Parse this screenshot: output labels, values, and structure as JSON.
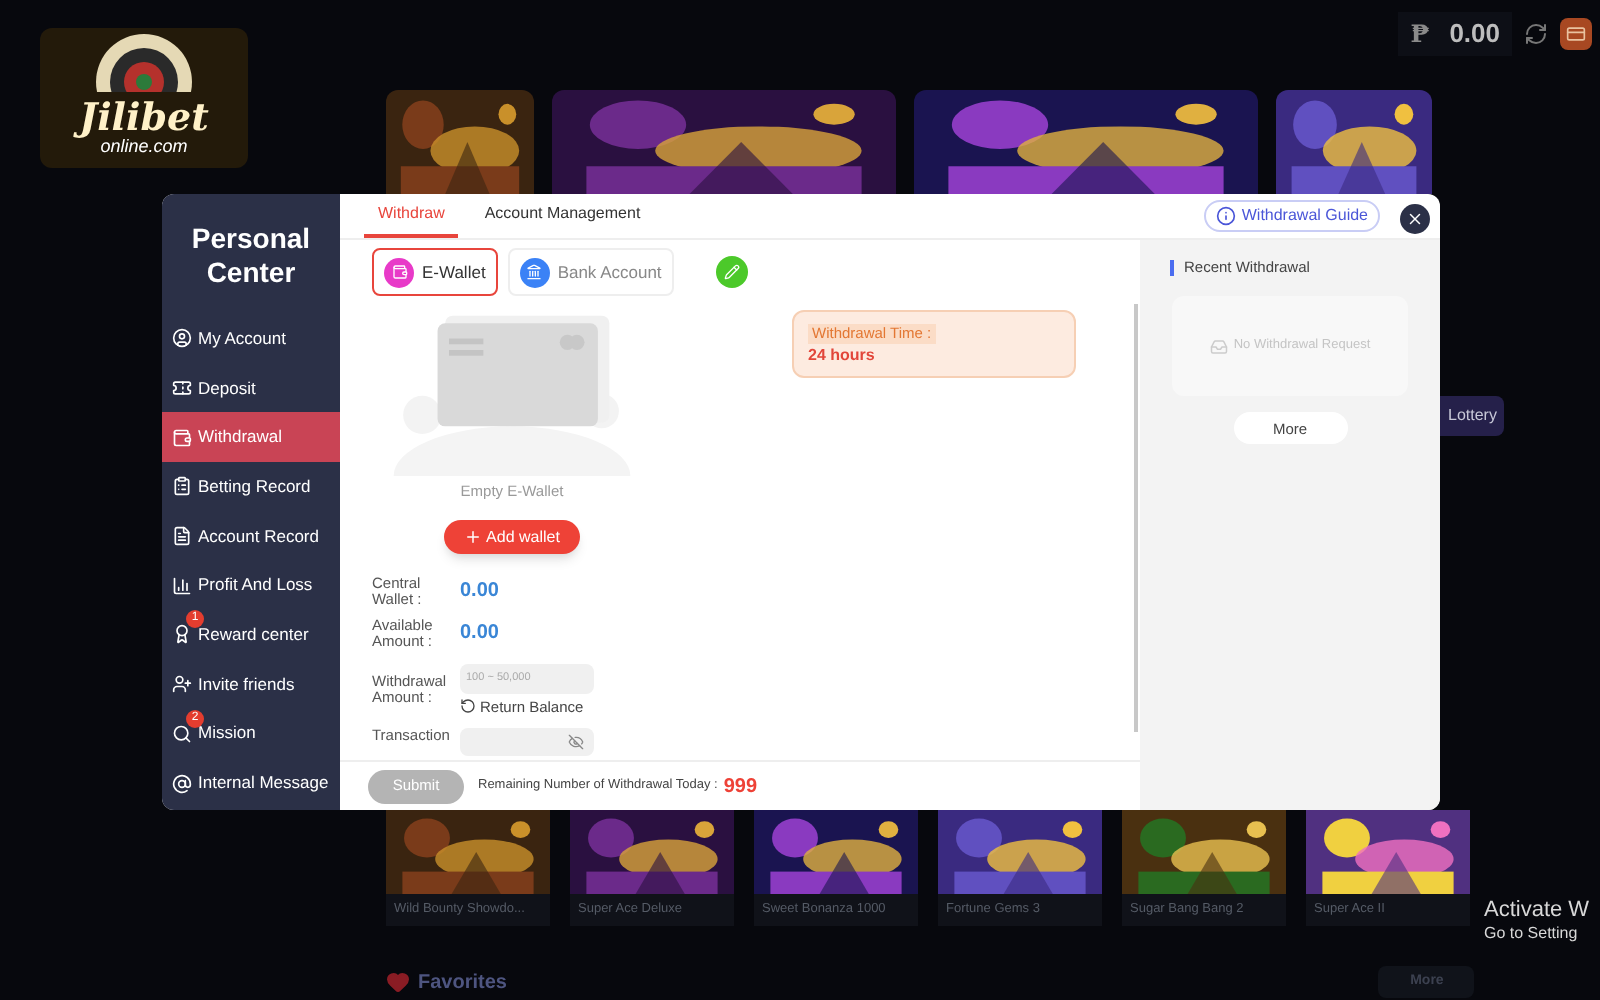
{
  "logo": {
    "name": "Jilibet",
    "domain": "online.com"
  },
  "balance": {
    "currency": "₱",
    "amount": "0.00"
  },
  "side_chip": "Lottery",
  "dialog": {
    "title": "Personal Center",
    "menu": [
      {
        "label": "My Account",
        "selected": false
      },
      {
        "label": "Deposit",
        "selected": false
      },
      {
        "label": "Withdrawal",
        "selected": true
      },
      {
        "label": "Betting Record",
        "selected": false
      },
      {
        "label": "Account Record",
        "selected": false
      },
      {
        "label": "Profit And Loss",
        "selected": false
      },
      {
        "label": "Reward center",
        "selected": false,
        "badge": "1"
      },
      {
        "label": "Invite friends",
        "selected": false
      },
      {
        "label": "Mission",
        "selected": false,
        "badge": "2"
      },
      {
        "label": "Internal Message",
        "selected": false
      }
    ],
    "tabs": [
      {
        "label": "Withdraw",
        "selected": true
      },
      {
        "label": "Account Management",
        "selected": false
      }
    ],
    "guide_button": "Withdrawal Guide",
    "wallet_types": [
      {
        "label": "E-Wallet",
        "selected": true
      },
      {
        "label": "Bank Account",
        "selected": false
      }
    ],
    "empty_text": "Empty E-Wallet",
    "add_button": "Add wallet",
    "notice": {
      "label": "Withdrawal Time :",
      "value": "24 hours"
    },
    "fields": [
      {
        "kind": "value",
        "label": "Central Wallet :",
        "value": "0.00"
      },
      {
        "kind": "value",
        "label": "Available Amount :",
        "value": "0.00"
      },
      {
        "kind": "input",
        "label": "Withdrawal Amount :",
        "placeholder": "100 ~ 50,000",
        "link": "Return Balance"
      },
      {
        "kind": "password",
        "label": "Transaction"
      }
    ],
    "submit": {
      "label": "Submit",
      "disabled": true
    },
    "remaining": {
      "label": "Remaining Number of Withdrawal Today :",
      "value": "999"
    },
    "recent": {
      "title": "Recent Withdrawal",
      "empty": "No Withdrawal Request",
      "more": "More"
    }
  },
  "games": [
    {
      "name": "Wild Bounty Showdo..."
    },
    {
      "name": "Super Ace Deluxe"
    },
    {
      "name": "Sweet Bonanza 1000"
    },
    {
      "name": "Fortune Gems 3"
    },
    {
      "name": "Sugar Bang Bang 2"
    },
    {
      "name": "Super Ace II"
    }
  ],
  "favorites": {
    "title": "Favorites",
    "more": "More"
  },
  "os_notice": {
    "title": "Activate W",
    "subtitle": "Go to Setting"
  }
}
